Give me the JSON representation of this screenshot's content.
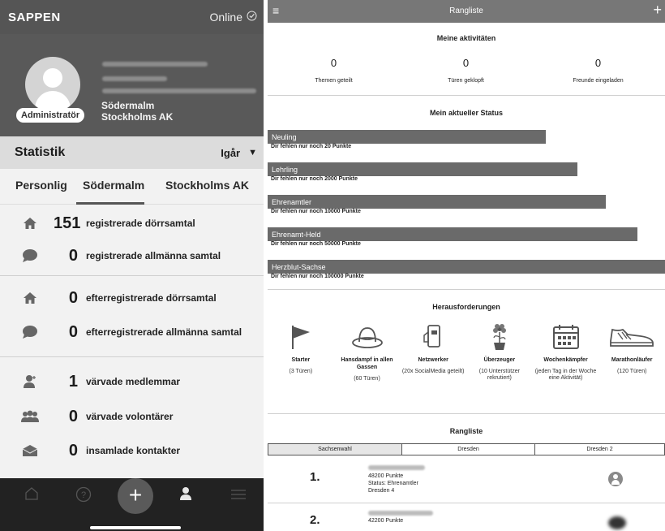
{
  "left": {
    "app_name": "SAPPEN",
    "status": "Online",
    "status_icon": "check-circle-icon",
    "role_badge": "Administratör",
    "org_local": "Södermalm",
    "org_region": "Stockholms AK",
    "stats_title": "Statistik",
    "period": "Igår",
    "tabs": [
      "Personlig",
      "Södermalm",
      "Stockholms AK"
    ],
    "active_tab": "Södermalm",
    "groups": [
      [
        {
          "icon": "house-icon",
          "value": "151",
          "label": "registrerade dörrsamtal"
        },
        {
          "icon": "speech-bubble-icon",
          "value": "0",
          "label": "registrerade allmänna samtal"
        }
      ],
      [
        {
          "icon": "house-icon",
          "value": "0",
          "label": "efterregistrerade dörrsamtal"
        },
        {
          "icon": "speech-bubble-icon",
          "value": "0",
          "label": "efterregistrerade allmänna samtal"
        }
      ],
      [
        {
          "icon": "person-add-icon",
          "value": "1",
          "label": "värvade medlemmar"
        },
        {
          "icon": "group-icon",
          "value": "0",
          "label": "värvade volontärer"
        },
        {
          "icon": "envelope-icon",
          "value": "0",
          "label": "insamlade kontakter"
        }
      ]
    ],
    "bottom_nav": [
      "home-icon",
      "help-icon",
      "add-button",
      "profile-icon",
      "menu-icon"
    ],
    "colors": {
      "header": "#555555",
      "profile_bg": "#595959",
      "stat_head": "#dcdcdc",
      "nav_bg": "#222222"
    }
  },
  "right": {
    "title": "Rangliste",
    "activities_title": "Meine aktivitäten",
    "activities": [
      {
        "value": "0",
        "label": "Themen geteilt"
      },
      {
        "value": "0",
        "label": "Türen geklopft"
      },
      {
        "value": "0",
        "label": "Freunde eingeladen"
      }
    ],
    "status_title": "Mein aktueller Status",
    "levels": [
      {
        "name": "Neuling",
        "hint": "Dir fehlen nur noch 20 Punkte",
        "fill": 0.7
      },
      {
        "name": "Lehrling",
        "hint": "Dir fehlen nur noch 2000 Punkte",
        "fill": 0.78
      },
      {
        "name": "Ehrenamtler",
        "hint": "Dir fehlen nur noch 10000 Punkte",
        "fill": 0.85
      },
      {
        "name": "Ehrenamt-Held",
        "hint": "Dir fehlen nur noch 50000 Punkte",
        "fill": 0.93
      },
      {
        "name": "Herzblut-Sachse",
        "hint": "Dir fehlen nur noch 100000 Punkte",
        "fill": 1.0
      }
    ],
    "challenges_title": "Herausforderungen",
    "challenges": [
      {
        "icon": "flag-icon",
        "name": "Starter",
        "desc": "(3 Türen)"
      },
      {
        "icon": "hat-icon",
        "name": "Hansdampf in allen Gassen",
        "desc": "(60 Türen)"
      },
      {
        "icon": "phone-share-icon",
        "name": "Netzwerker",
        "desc": "(20x SocialMedia geteilt)"
      },
      {
        "icon": "flower-icon",
        "name": "Überzeuger",
        "desc": "(10 Unterstützer rekrutiert)"
      },
      {
        "icon": "calendar-icon",
        "name": "Wochenkämpfer",
        "desc": "(jeden Tag in der Woche eine Aktivität)"
      },
      {
        "icon": "sneaker-icon",
        "name": "Marathonläufer",
        "desc": "(120 Türen)"
      }
    ],
    "ranking_title": "Rangliste",
    "ranking_tabs": [
      "Sachsenwahl",
      "Dresden",
      "Dresden 2"
    ],
    "active_ranking_tab": "Sachsenwahl",
    "entries": [
      {
        "rank": "1.",
        "points": "48200 Punkte",
        "status": "Status: Ehrenamtler",
        "team": "Dresden 4"
      },
      {
        "rank": "2.",
        "points": "42200 Punkte"
      }
    ],
    "colors": {
      "topbar": "#777777",
      "level_bar": "#6a6a6a",
      "tab_active": "#e6e6e6"
    }
  }
}
